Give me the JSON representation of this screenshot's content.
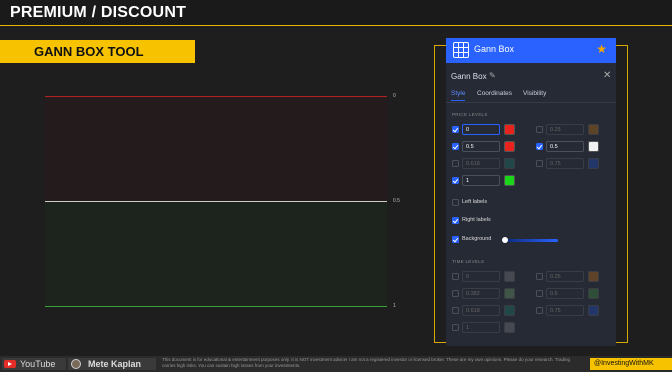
{
  "slide": {
    "title": "PREMIUM / DISCOUNT",
    "banner": "GANN BOX TOOL"
  },
  "chart": {
    "labels": [
      "0",
      "0.5",
      "1"
    ],
    "colors": {
      "top_line": "#b22222",
      "mid_line": "#cccccc",
      "bottom_line": "#3aa03a"
    }
  },
  "dialog": {
    "header_title": "Gann Box",
    "header_icon": "gann-box-icon",
    "favorite_icon": "star-icon",
    "title": "Gann Box",
    "tabs": [
      "Style",
      "Coordinates",
      "Visibility"
    ],
    "active_tab": "Style",
    "price_levels_title": "PRICE LEVELS",
    "price_levels": [
      {
        "checked": true,
        "value": "0",
        "color": "#e8221d"
      },
      {
        "checked": false,
        "value": "0.25",
        "color": "#a0651b"
      },
      {
        "checked": true,
        "value": "0.5",
        "color": "#e8221d"
      },
      {
        "checked": true,
        "value": "0.5",
        "color": "#f2f2f2"
      },
      {
        "checked": false,
        "value": "0.618",
        "color": "#1c6b63"
      },
      {
        "checked": false,
        "value": "0.75",
        "color": "#2146a8"
      },
      {
        "checked": true,
        "value": "1",
        "color": "#19d619"
      }
    ],
    "left_labels": {
      "label": "Left labels",
      "checked": false
    },
    "right_labels": {
      "label": "Right labels",
      "checked": true
    },
    "background": {
      "label": "Background",
      "checked": true,
      "opacity": 0.1
    },
    "time_levels_title": "TIME LEVELS",
    "time_levels": [
      {
        "checked": false,
        "value": "0",
        "color": "#6d6f75"
      },
      {
        "checked": false,
        "value": "0.25",
        "color": "#a0651b"
      },
      {
        "checked": false,
        "value": "0.382",
        "color": "#5e8a5e"
      },
      {
        "checked": false,
        "value": "0.5",
        "color": "#3a7a3a"
      },
      {
        "checked": false,
        "value": "0.618",
        "color": "#1c6b63"
      },
      {
        "checked": false,
        "value": "0.75",
        "color": "#2146a8"
      },
      {
        "checked": false,
        "value": "1",
        "color": "#6d6f75"
      }
    ]
  },
  "footer": {
    "youtube": "YouTube",
    "author": "Mete Kaplan",
    "disclaimer": "This document is for educational & entertainment purposes only. It is NOT investment advice! I am not a registered investor or licensed broker. These are my own opinions. Please do your research. Trading carries high risks. You can sustain high losses from your investments.",
    "handle": "@InvestingWithMK"
  }
}
